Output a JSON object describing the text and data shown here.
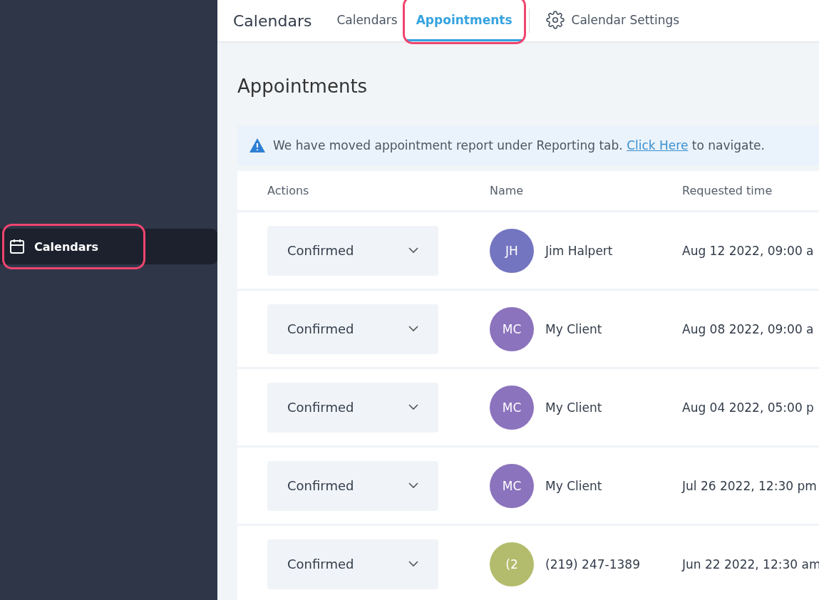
{
  "sidebar": {
    "items": [
      {
        "label": "Calendars",
        "selected": true,
        "highlighted": true
      }
    ]
  },
  "top_nav": {
    "title": "Calendars",
    "tabs": [
      {
        "label": "Calendars",
        "selected": false,
        "highlighted": false,
        "kind": "plain"
      },
      {
        "label": "Appointments",
        "selected": true,
        "highlighted": true,
        "kind": "plain"
      },
      {
        "label": "Calendar Settings",
        "selected": false,
        "highlighted": false,
        "kind": "settings"
      }
    ]
  },
  "page_title": "Appointments",
  "notice": {
    "text": "We have moved appointment report under Reporting tab.",
    "link": "Click Here",
    "after": "to navigate."
  },
  "table": {
    "columns": [
      "Actions",
      "Name",
      "Requested time"
    ],
    "rows": [
      {
        "status": "Confirmed",
        "initials": "JH",
        "color": "#7475c0",
        "name": "Jim Halpert",
        "time": "Aug 12 2022, 09:00 a"
      },
      {
        "status": "Confirmed",
        "initials": "MC",
        "color": "#8b73bd",
        "name": "My Client",
        "time": "Aug 08 2022, 09:00 a"
      },
      {
        "status": "Confirmed",
        "initials": "MC",
        "color": "#8b73bd",
        "name": "My Client",
        "time": "Aug 04 2022, 05:00 p"
      },
      {
        "status": "Confirmed",
        "initials": "MC",
        "color": "#8b73bd",
        "name": "My Client",
        "time": "Jul 26 2022, 12:30 pm"
      },
      {
        "status": "Confirmed",
        "initials": "(2",
        "color": "#b3bc6c",
        "name": "(219) 247-1389",
        "time": "Jun 22 2022, 12:30 am"
      }
    ]
  }
}
